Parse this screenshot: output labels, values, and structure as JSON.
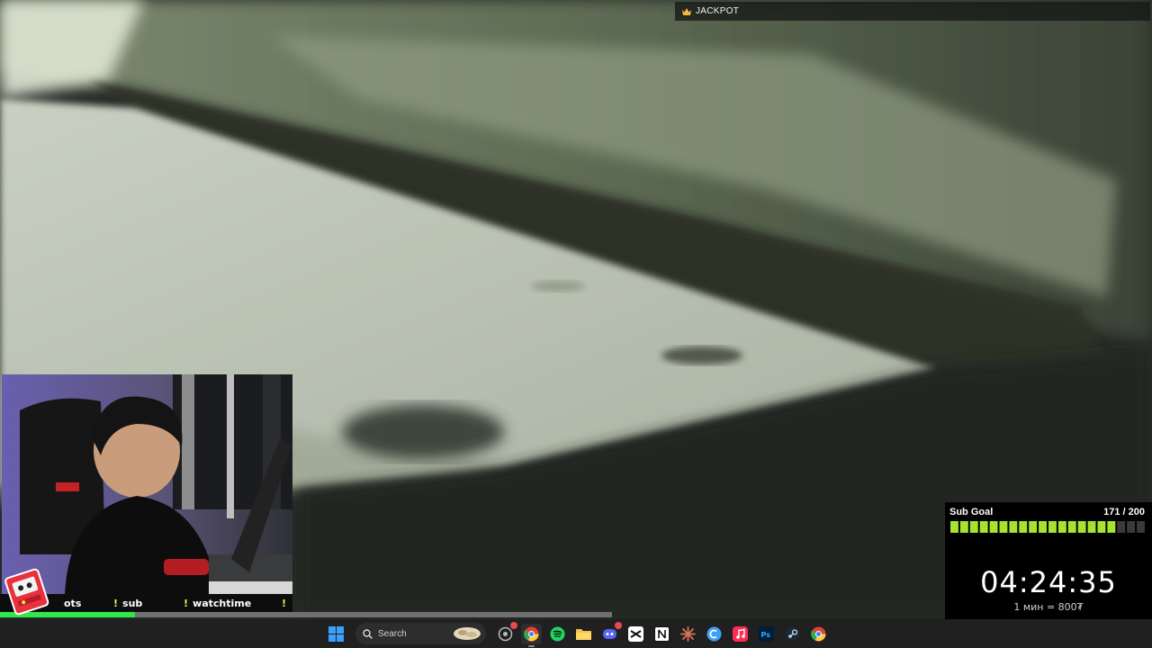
{
  "overlay": {
    "jackpot_label": "JACKPOT"
  },
  "ticker": {
    "items": [
      {
        "bang": "",
        "label": "ots"
      },
      {
        "bang": "!",
        "label": "sub"
      },
      {
        "bang": "!",
        "label": "watchtime"
      },
      {
        "bang": "!",
        "label": ""
      }
    ],
    "progress": 0.22
  },
  "subgoal": {
    "title": "Sub Goal",
    "count": "171 / 200",
    "current": 171,
    "target": 200,
    "timer": "04:24:35",
    "rate": "1 мин = 800₮",
    "accent_color": "#a6e22e"
  },
  "taskbar": {
    "search_placeholder": "Search",
    "icons": [
      "windows-start-icon",
      "search-icon",
      "copilot-icon",
      "chrome-icon",
      "spotify-icon",
      "file-explorer-icon",
      "discord-icon",
      "capcut-icon",
      "notion-icon",
      "claude-icon",
      "cursor-icon",
      "music-icon",
      "photoshop-icon",
      "steam-icon",
      "chrome-alt-icon"
    ]
  },
  "colors": {
    "ticker_bang": "#e7f84a",
    "progress_fill": "#2ee84c",
    "goal_segment": "#a6e22e",
    "timer_underline": "#f2ee1e"
  }
}
